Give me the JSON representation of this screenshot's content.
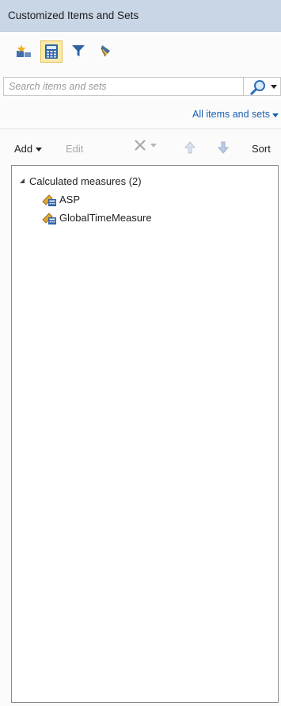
{
  "window": {
    "title": "Customized Items and Sets"
  },
  "toolbar": {
    "buttons": [
      {
        "icon": "new-item-icon",
        "active": false
      },
      {
        "icon": "calculator-icon",
        "active": true
      },
      {
        "icon": "filter-icon",
        "active": false
      },
      {
        "icon": "highlight-icon",
        "active": false
      }
    ]
  },
  "search": {
    "placeholder": "Search items and sets",
    "value": ""
  },
  "filter": {
    "label": "All items and sets"
  },
  "commands": {
    "add": "Add",
    "edit": "Edit",
    "delete_icon": "delete-x-icon",
    "move_up_icon": "arrow-up-icon",
    "move_down_icon": "arrow-down-icon",
    "sort": "Sort"
  },
  "tree": {
    "group_label": "Calculated measures (2)",
    "items": [
      {
        "label": "ASP",
        "icon": "calculated-measure-icon"
      },
      {
        "label": "GlobalTimeMeasure",
        "icon": "calculated-measure-icon"
      }
    ]
  },
  "colors": {
    "titlebar_bg": "#c9d6e6",
    "active_tool_bg": "#fbe9a8",
    "link": "#1a5fb4"
  }
}
